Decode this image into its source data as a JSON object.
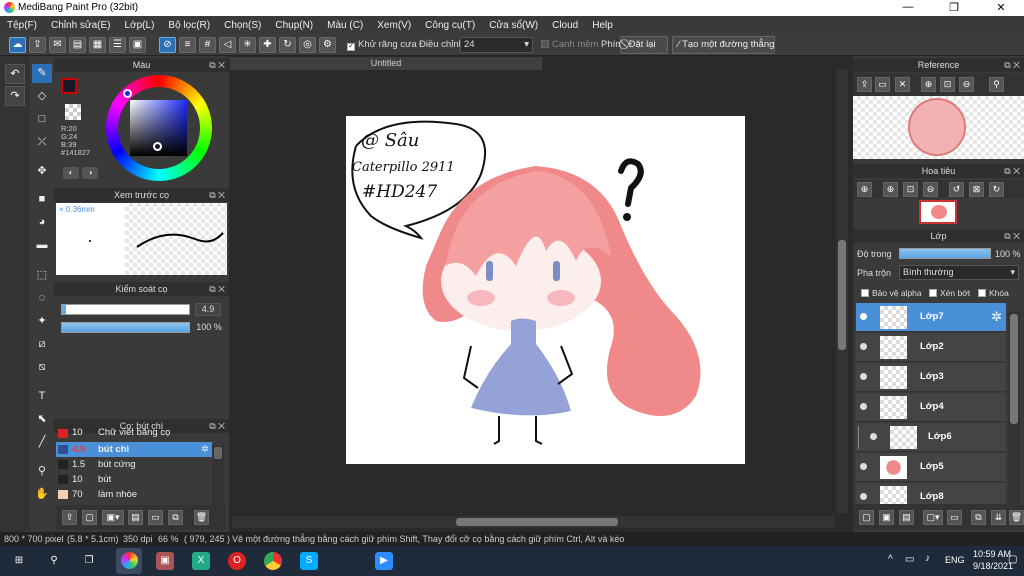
{
  "window": {
    "title": "MediBang Paint Pro (32bit)",
    "minimize": "—",
    "maximize": "❐",
    "close": "✕"
  },
  "menu": [
    "Tệp(F)",
    "Chỉnh sửa(E)",
    "Lớp(L)",
    "Bộ lọc(R)",
    "Chọn(S)",
    "Chụp(N)",
    "Màu (C)",
    "Xem(V)",
    "Công cụ(T)",
    "Cửa sổ(W)",
    "Cloud",
    "Help"
  ],
  "toolbar": {
    "antialias_label": "Khử răng cưa",
    "adjust_label": "Điều chỉnh",
    "adjust_value": "24",
    "snap_label": "Canh mềm",
    "key_label": "Phím",
    "reset_label": "Đặt lại",
    "line_label": "Tạo một đường thẳng"
  },
  "color_panel": {
    "title": "Màu",
    "r": "R:20",
    "g": "G:24",
    "b": "B:39",
    "hex": "#141827",
    "primary_color": "#141827",
    "accent": "#cc0000"
  },
  "preview_panel": {
    "title": "Xem trước cọ",
    "size": "0.36mm"
  },
  "brush_control": {
    "title": "Kiểm soát cọ",
    "size_value": "4.9",
    "opacity_value": "100 %",
    "size_fraction": 0.98,
    "opacity_fraction": 1.0
  },
  "brush_list": {
    "title": "Cọ: bút chì",
    "items": [
      {
        "size": "10",
        "name": "Chữ viết bằng cọ",
        "color": "#d22"
      },
      {
        "size": "4.9",
        "name": "bút chì",
        "color": "#4a90d9"
      },
      {
        "size": "1.5",
        "name": "bút cứng",
        "color": "#222"
      },
      {
        "size": "10",
        "name": "bút",
        "color": "#222"
      },
      {
        "size": "70",
        "name": "làm nhòe",
        "color": "#f5d0b0"
      }
    ]
  },
  "document": {
    "tab": "Untitled"
  },
  "artwork": {
    "handle": "@ Sâu",
    "name": "Caterpillo 2911",
    "tag": "#HD247",
    "mark": "?"
  },
  "reference_panel": {
    "title": "Reference"
  },
  "navigator_panel": {
    "title": "Hoa tiêu"
  },
  "layer_panel": {
    "title": "Lớp",
    "opacity_label": "Độ trong",
    "opacity_value": "100 %",
    "blend_label": "Pha trộn",
    "blend_value": "Bình thường",
    "protect_alpha": "Bảo vệ alpha",
    "clip": "Xén bớt",
    "lock": "Khóa",
    "layers": [
      "Lớp7",
      "Lớp2",
      "Lớp3",
      "Lớp4",
      "Lớp6",
      "Lớp5",
      "Lớp8"
    ]
  },
  "status": {
    "size": "800 * 700 pixel",
    "cm": "(5.8 * 5.1cm)",
    "dpi": "350 dpi",
    "zoom": "66 %",
    "coord": "( 979, 245 )",
    "hint": "Vẽ một đường thẳng bằng cách giữ phím Shift, Thay đổi cỡ cọ bằng cách giữ phím Ctrl, Alt và kéo"
  },
  "taskbar": {
    "lang": "ENG",
    "time": "10:59 AM",
    "date": "9/18/2021"
  }
}
